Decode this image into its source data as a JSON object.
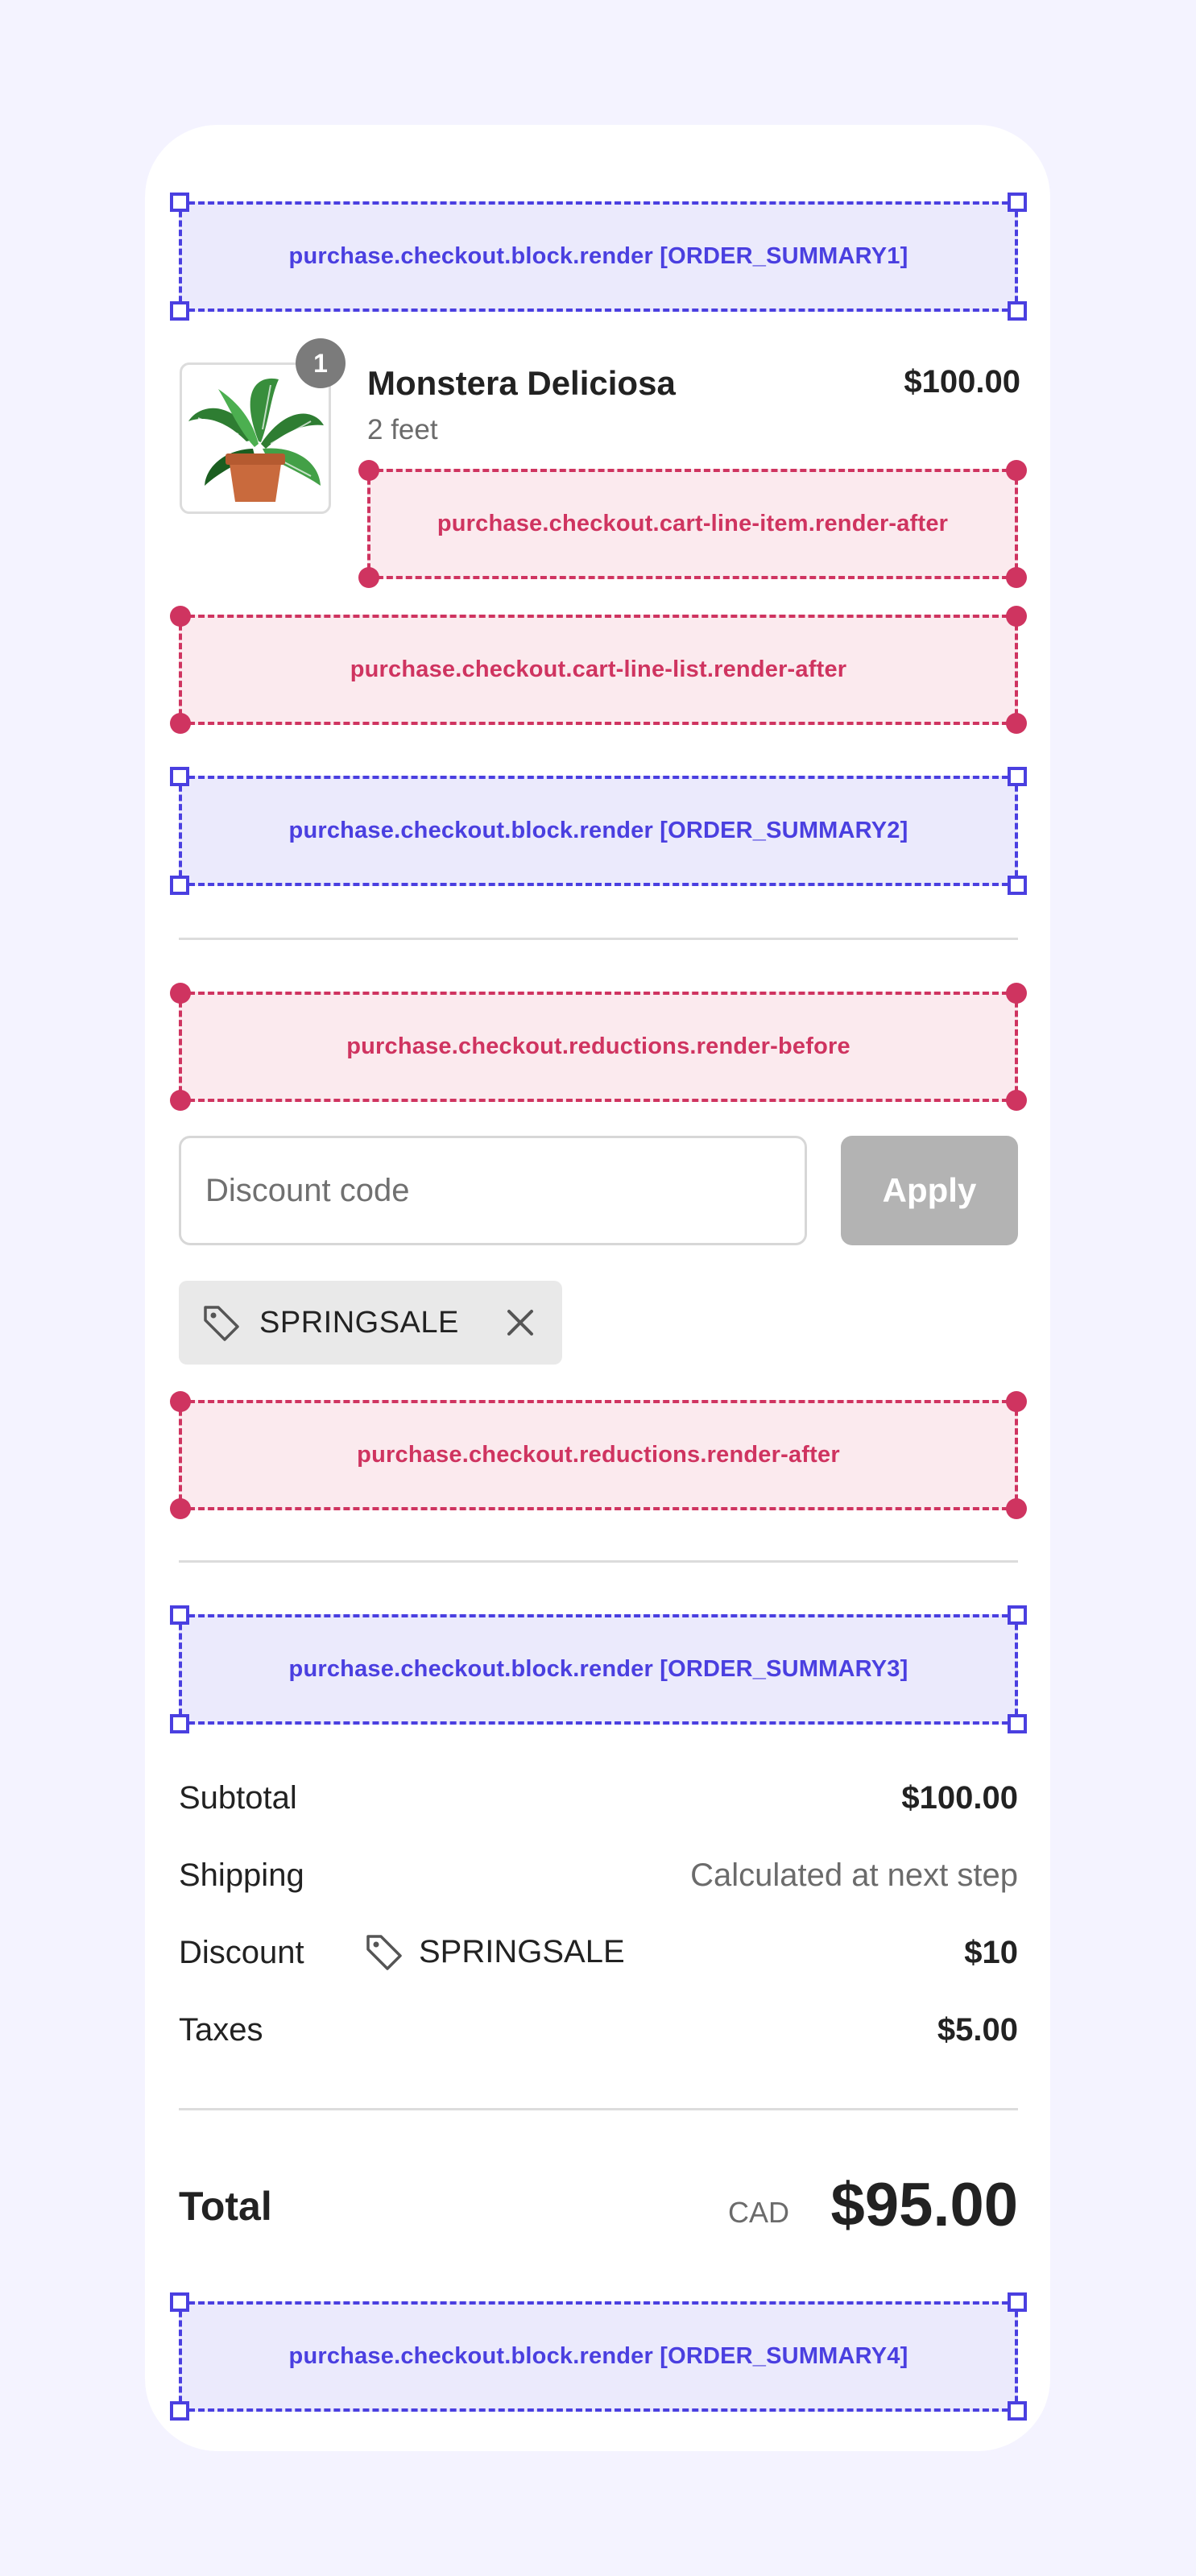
{
  "targets": {
    "order_summary1": "purchase.checkout.block.render [ORDER_SUMMARY1]",
    "cart_line_item_after": "purchase.checkout.cart-line-item.render-after",
    "cart_line_list_after": "purchase.checkout.cart-line-list.render-after",
    "order_summary2": "purchase.checkout.block.render [ORDER_SUMMARY2]",
    "reductions_before": "purchase.checkout.reductions.render-before",
    "reductions_after": "purchase.checkout.reductions.render-after",
    "order_summary3": "purchase.checkout.block.render [ORDER_SUMMARY3]",
    "order_summary4": "purchase.checkout.block.render [ORDER_SUMMARY4]"
  },
  "line_item": {
    "quantity": "1",
    "name": "Monstera Deliciosa",
    "variant": "2 feet",
    "price": "$100.00",
    "image_icon": "potted-plant-image"
  },
  "discount": {
    "placeholder": "Discount code",
    "value": "",
    "apply_label": "Apply",
    "applied_code": "SPRINGSALE",
    "tag_icon": "tag-icon",
    "remove_icon": "close-icon"
  },
  "summary": {
    "subtotal_label": "Subtotal",
    "subtotal_value": "$100.00",
    "shipping_label": "Shipping",
    "shipping_value": "Calculated at next step",
    "discount_label": "Discount",
    "discount_code": "SPRINGSALE",
    "discount_value": "$10",
    "taxes_label": "Taxes",
    "taxes_value": "$5.00"
  },
  "total": {
    "label": "Total",
    "currency": "CAD",
    "value": "$95.00"
  },
  "colors": {
    "background": "#f4f3ff",
    "block_target": "#4a3fe0",
    "static_target": "#cf3460",
    "apply_disabled": "#b3b3b3"
  }
}
